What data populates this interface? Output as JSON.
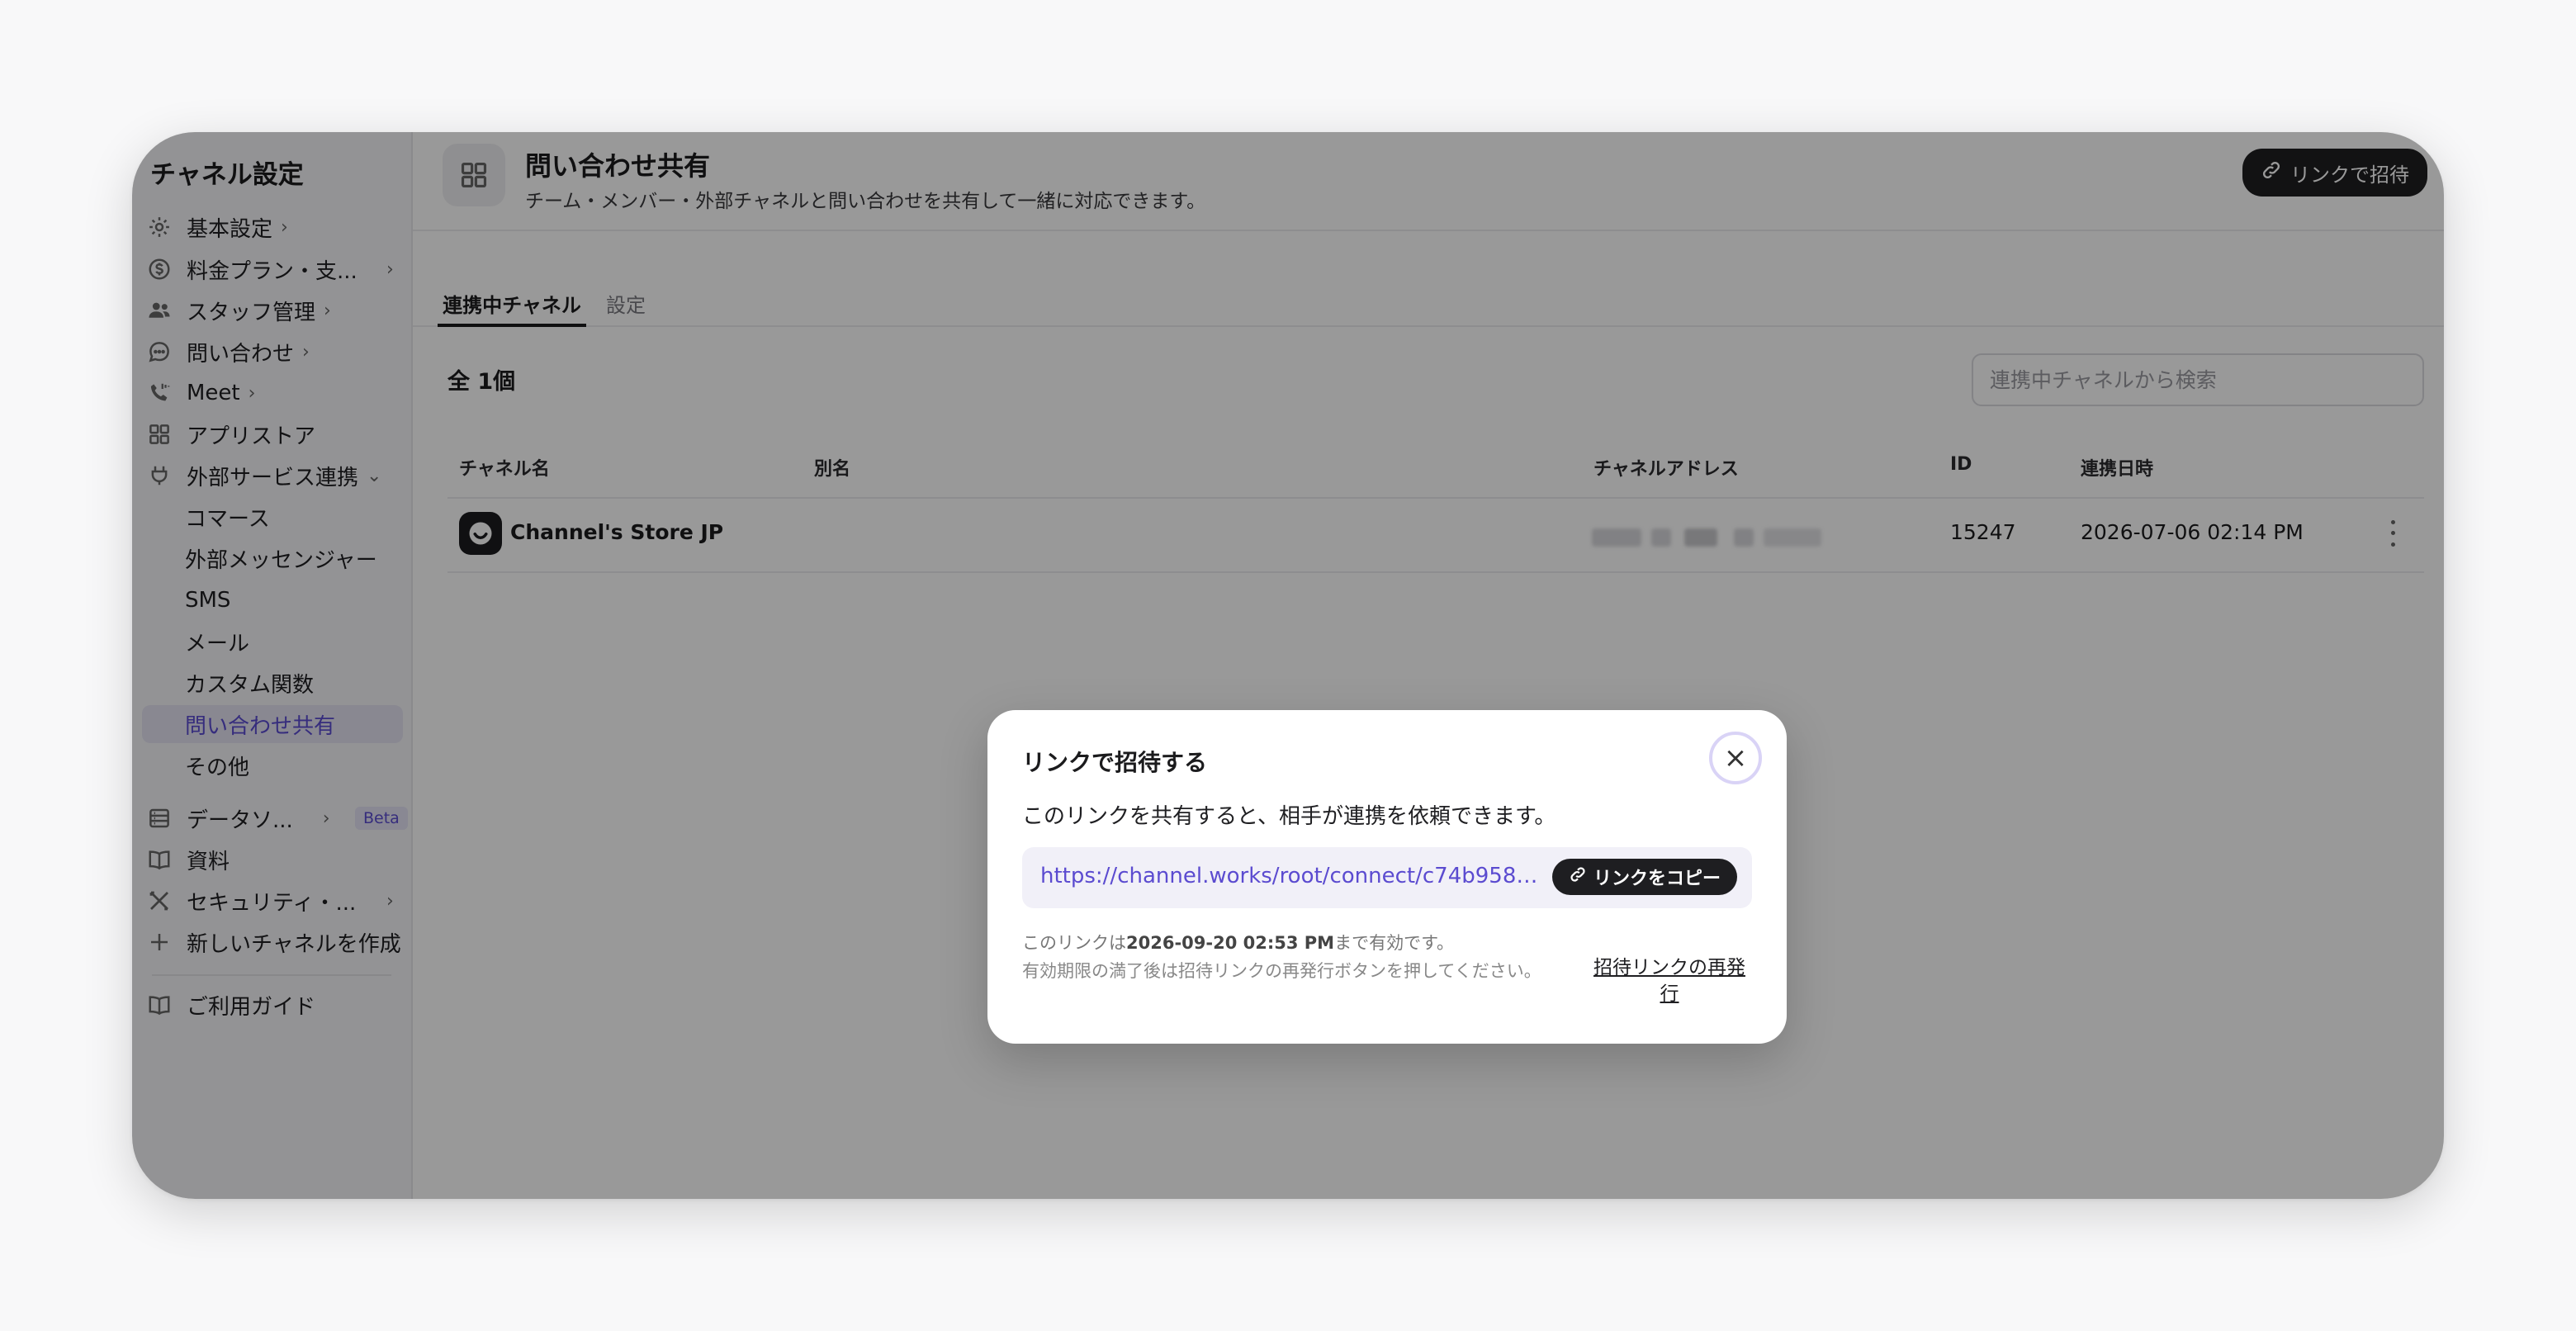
{
  "sidebar": {
    "title": "チャネル設定",
    "items": [
      {
        "label": "基本設定"
      },
      {
        "label": "料金プラン・支..."
      },
      {
        "label": "スタッフ管理"
      },
      {
        "label": "問い合わせ"
      },
      {
        "label": "Meet"
      },
      {
        "label": "アプリストア"
      },
      {
        "label": "外部サービス連携"
      },
      {
        "label": "コマース"
      },
      {
        "label": "外部メッセンジャー"
      },
      {
        "label": "SMS"
      },
      {
        "label": "メール"
      },
      {
        "label": "カスタム関数"
      },
      {
        "label": "問い合わせ共有"
      },
      {
        "label": "その他"
      },
      {
        "label": "データソ...",
        "badge": "Beta"
      },
      {
        "label": "資料"
      },
      {
        "label": "セキュリティ・..."
      },
      {
        "label": "新しいチャネルを作成"
      },
      {
        "label": "ご利用ガイド"
      }
    ]
  },
  "header": {
    "title": "問い合わせ共有",
    "subtitle": "チーム・メンバー・外部チャネルと問い合わせを共有して一緒に対応できます。",
    "invite_button": "リンクで招待"
  },
  "tabs": [
    {
      "label": "連携中チャネル",
      "active": true
    },
    {
      "label": "設定",
      "active": false
    }
  ],
  "list": {
    "count_label": "全 1個",
    "search_placeholder": "連携中チャネルから検索",
    "columns": [
      "チャネル名",
      "別名",
      "チャネルアドレス",
      "ID",
      "連携日時"
    ],
    "rows": [
      {
        "name": "Channel's Store JP",
        "alias": "",
        "id": "15247",
        "date": "2026-07-06 02:14 PM"
      }
    ]
  },
  "modal": {
    "title": "リンクで招待する",
    "description": "このリンクを共有すると、相手が連携を依頼できます。",
    "url": "https://channel.works/root/connect/c74b958f-18...",
    "copy_button": "リンクをコピー",
    "expiry_prefix": "このリンクは",
    "expiry_date": "2026-09-20 02:53 PM",
    "expiry_suffix": "まで有効です。",
    "expiry_note": "有効期限の満了後は招待リンクの再発行ボタンを押してください。",
    "reissue_link": "招待リンクの再発行"
  },
  "colors": {
    "accent": "#5b4bd0",
    "active_bg": "#e4e3f2",
    "dark_button": "#1e1e21"
  }
}
